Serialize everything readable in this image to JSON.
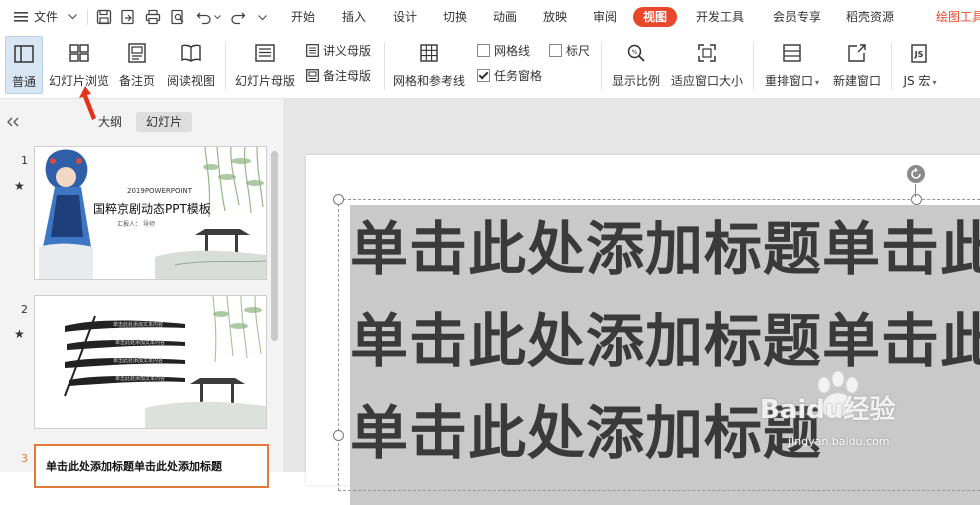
{
  "menubar": {
    "file_label": "文件",
    "tabs": [
      "开始",
      "插入",
      "设计",
      "切换",
      "动画",
      "放映",
      "审阅",
      "视图",
      "开发工具",
      "会员专享",
      "稻壳资源"
    ],
    "active_tab": "视图",
    "right_label": "绘图工具"
  },
  "ribbon": {
    "normal": "普通",
    "slide_sorter": "幻灯片浏览",
    "notes_page": "备注页",
    "reading_view": "阅读视图",
    "slide_master": "幻灯片母版",
    "handout_master": "讲义母版",
    "notes_master": "备注母版",
    "grid_guides": "网格和参考线",
    "gridlines": "网格线",
    "ruler": "标尺",
    "task_pane": "任务窗格",
    "zoom": "显示比例",
    "fit_window": "适应窗口大小",
    "arrange": "重排窗口",
    "new_window": "新建窗口",
    "js_macro": "JS 宏"
  },
  "checkboxes": {
    "gridlines": false,
    "ruler": false,
    "task_pane": true
  },
  "leftpanel": {
    "tab_outline": "大纲",
    "tab_slides": "幻灯片",
    "slides": [
      {
        "number": "1",
        "line1": "2019POWERPOINT",
        "title": "国粹京剧动态PPT模板",
        "reporter": "汇报人：",
        "reporter_value": "导师"
      },
      {
        "number": "2",
        "items": [
          "单击此处添加文本内容",
          "单击此处添加文本内容",
          "单击此处添加文本内容",
          "单击此处添加文本内容"
        ]
      },
      {
        "number": "3",
        "title": "单击此处添加标题单击此处添加标题"
      }
    ]
  },
  "slide": {
    "title_lines": [
      "单击此处添加标题单击此处添加标题",
      "单击此处添加标题单击此处添加标题",
      "单击此处添加标题"
    ]
  },
  "watermark": {
    "brand": "Baidu经验",
    "url": "jingyan.baidu.com"
  },
  "colors": {
    "accent": "#e8472b",
    "selected_thumb": "#e07b39",
    "arrow": "#e8311a"
  }
}
